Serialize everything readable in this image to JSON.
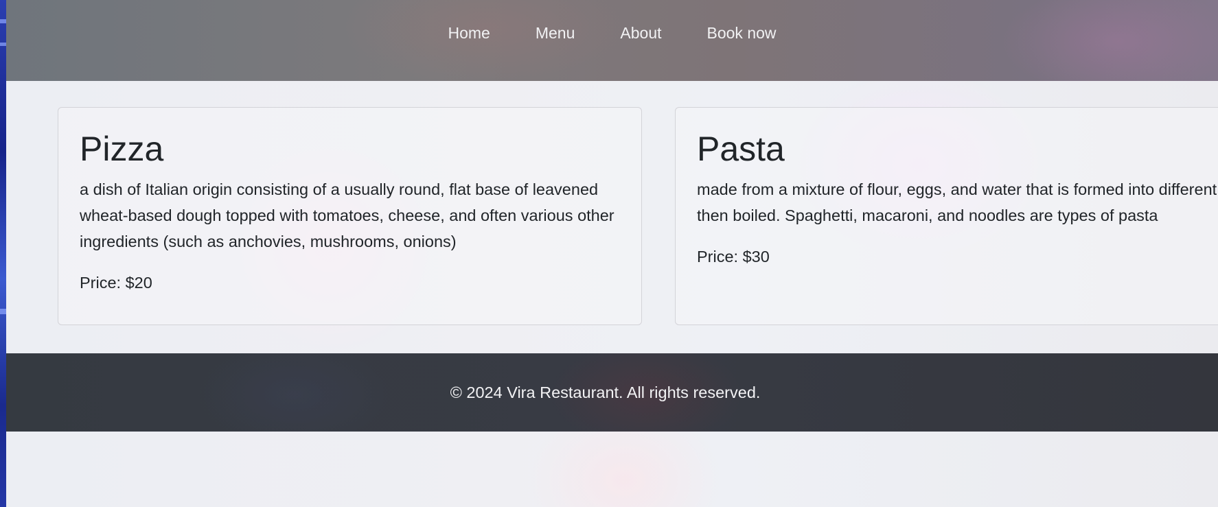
{
  "nav": {
    "items": [
      {
        "label": "Home"
      },
      {
        "label": "Menu"
      },
      {
        "label": "About"
      },
      {
        "label": "Book now"
      }
    ]
  },
  "menu_items": [
    {
      "title": "Pizza",
      "description": "a dish of Italian origin consisting of a usually round, flat base of leavened wheat-based dough topped with tomatoes, cheese, and often various other ingredients (such as anchovies, mushrooms, onions)",
      "price": "Price: $20"
    },
    {
      "title": "Pasta",
      "description": "made from a mixture of flour, eggs, and water that is formed into different shapes and then boiled. Spaghetti, macaroni, and noodles are types of pasta",
      "price": "Price: $30"
    }
  ],
  "footer": {
    "text": "© 2024 Vira Restaurant. All rights reserved."
  }
}
